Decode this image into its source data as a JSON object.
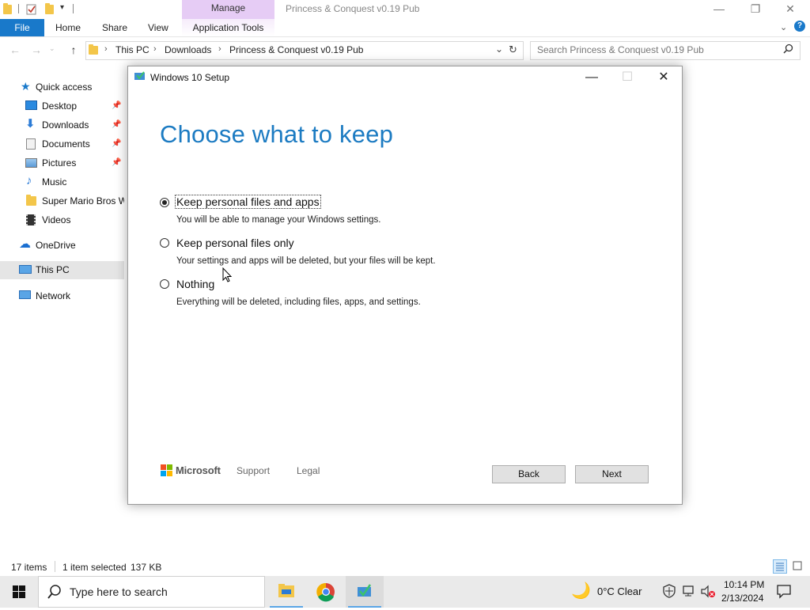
{
  "explorer": {
    "window_title": "Princess & Conquest v0.19 Pub",
    "context_tab": "Manage",
    "ribbon_tabs": {
      "file": "File",
      "home": "Home",
      "share": "Share",
      "view": "View",
      "app_tools": "Application Tools"
    },
    "breadcrumb": [
      "This PC",
      "Downloads",
      "Princess & Conquest v0.19 Pub"
    ],
    "search_placeholder": "Search Princess & Conquest v0.19 Pub",
    "sidebar": {
      "quick_access": "Quick access",
      "items": [
        "Desktop",
        "Downloads",
        "Documents",
        "Pictures",
        "Music",
        "Super Mario Bros W",
        "Videos"
      ],
      "onedrive": "OneDrive",
      "this_pc": "This PC",
      "network": "Network"
    },
    "status": {
      "items": "17 items",
      "selected": "1 item selected",
      "size": "137 KB"
    }
  },
  "dialog": {
    "title": "Windows 10 Setup",
    "heading": "Choose what to keep",
    "options": [
      {
        "label": "Keep personal files and apps",
        "description": "You will be able to manage your Windows settings.",
        "selected": true
      },
      {
        "label": "Keep personal files only",
        "description": "Your settings and apps will be deleted, but your files will be kept.",
        "selected": false
      },
      {
        "label": "Nothing",
        "description": "Everything will be deleted, including files, apps, and settings.",
        "selected": false
      }
    ],
    "footer": {
      "brand": "Microsoft",
      "support": "Support",
      "legal": "Legal",
      "back": "Back",
      "next": "Next"
    }
  },
  "taskbar": {
    "search_placeholder": "Type here to search",
    "weather": "0°C  Clear",
    "time": "10:14 PM",
    "date": "2/13/2024"
  },
  "colors": {
    "accent": "#1979ca",
    "heading": "#1c7bc2",
    "context_tab": "#e6ccf5"
  }
}
